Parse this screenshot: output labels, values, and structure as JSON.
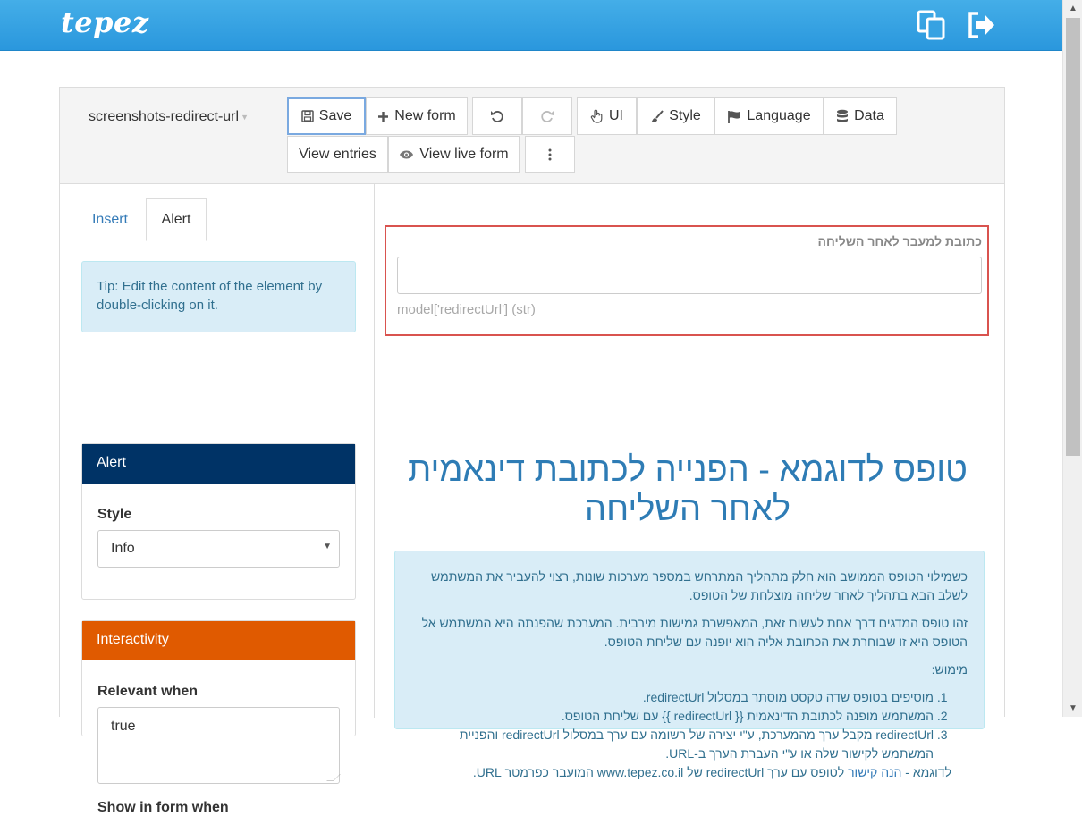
{
  "app": {
    "logo": "tepez"
  },
  "toolbar": {
    "form_name": "screenshots-redirect-url",
    "save_label": "Save",
    "new_form_label": "New form",
    "ui_label": "UI",
    "style_label": "Style",
    "language_label": "Language",
    "data_label": "Data",
    "view_entries_label": "View entries",
    "view_live_form_label": "View live form"
  },
  "sidebar": {
    "tabs": [
      {
        "label": "Insert"
      },
      {
        "label": "Alert"
      }
    ],
    "tip": "Tip: Edit the content of the element by double-clicking on it.",
    "alert_card": {
      "title": "Alert",
      "style_label": "Style",
      "style_value": "Info"
    },
    "interactivity_card": {
      "title": "Interactivity",
      "relevant_label": "Relevant when",
      "relevant_value": "true",
      "show_in_form_label": "Show in form when"
    }
  },
  "preview": {
    "field_label": "כתובת למעבר לאחר השליחה",
    "field_value": "",
    "field_help": "model['redirectUrl'] (str)",
    "title": "טופס לדוגמא - הפנייה לכתובת דינאמית לאחר השליחה",
    "paragraph1": "כשמילוי הטופס הממושב הוא חלק מתהליך המתרחש במספר מערכות שונות, רצוי להעביר את המשתמש לשלב הבא בתהליך לאחר שליחה מוצלחת של הטופס.",
    "paragraph2": "זהו טופס המדגים דרך אחת לעשות זאת, המאפשרת גמישות מירבית. המערכת שהפנתה היא המשתמש אל הטופס היא זו שבוחרת את הכתובת אליה הוא יופנה עם שליחת הטופס.",
    "usage_label": "מימוש:",
    "steps": [
      "מוסיפים בטופס שדה טקסט מוסתר במסלול redirectUrl.",
      "המשתמש מופנה לכתובת הדינאמית {{ redirectUrl }} עם שליחת הטופס.",
      "redirectUrl מקבל ערך מהמערכת, ע\"י יצירה של רשומה עם ערך במסלול redirectUrl והפניית המשתמש לקישור שלה או ע\"י העברת הערך ב-URL."
    ],
    "example_prefix": "לדוגמא -",
    "example_link": "הנה קישור",
    "example_suffix": "לטופס עם ערך redirectUrl של www.tepez.co.il המועבר כפרמטר URL."
  },
  "colors": {
    "topbar": "#2a97dd",
    "alert_header": "#003366",
    "interactivity_header": "#e05a00",
    "highlight_border": "#d9534f",
    "info_bg": "#d9edf7"
  }
}
